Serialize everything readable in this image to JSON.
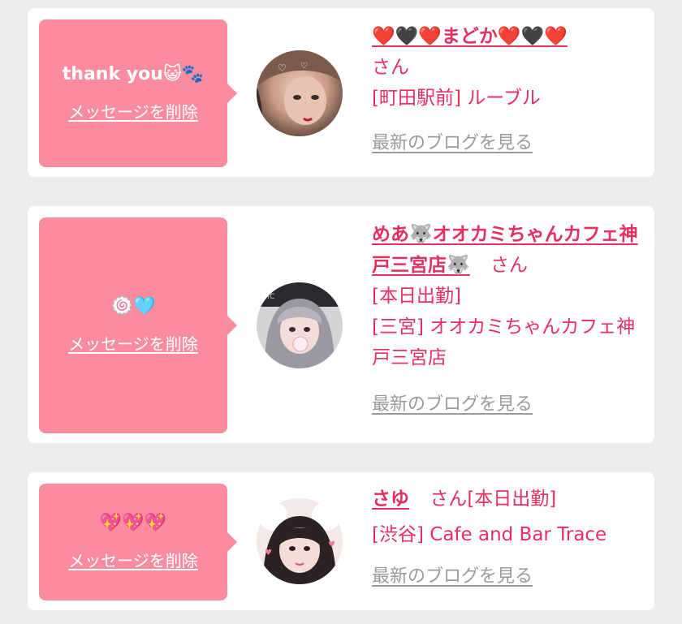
{
  "common": {
    "delete_label": "メッセージを削除",
    "blog_label": "最新のブログを見る",
    "honorific": "さん"
  },
  "cards": [
    {
      "message": "thank you😺🐾",
      "name": "❤️🖤❤️まどか❤️🖤❤️",
      "lines": [
        "[町田駅前] ルーブル"
      ]
    },
    {
      "message": "🍥🩵",
      "name": "めあ🐺オオカミちゃんカフェ神戸三宮店🐺",
      "lines": [
        "[本日出勤]",
        "[三宮] オオカミちゃんカフェ神戸三宮店"
      ]
    },
    {
      "message": "💖💖💖",
      "name": "さゆ",
      "inline_after_san": "[本日出勤]",
      "lines": [
        "[渋谷] Cafe and Bar Trace"
      ]
    }
  ],
  "colors": {
    "accent": "#e5305f",
    "bubble": "#fb8ca0",
    "muted": "#9a9a9a",
    "background": "#ececef"
  }
}
